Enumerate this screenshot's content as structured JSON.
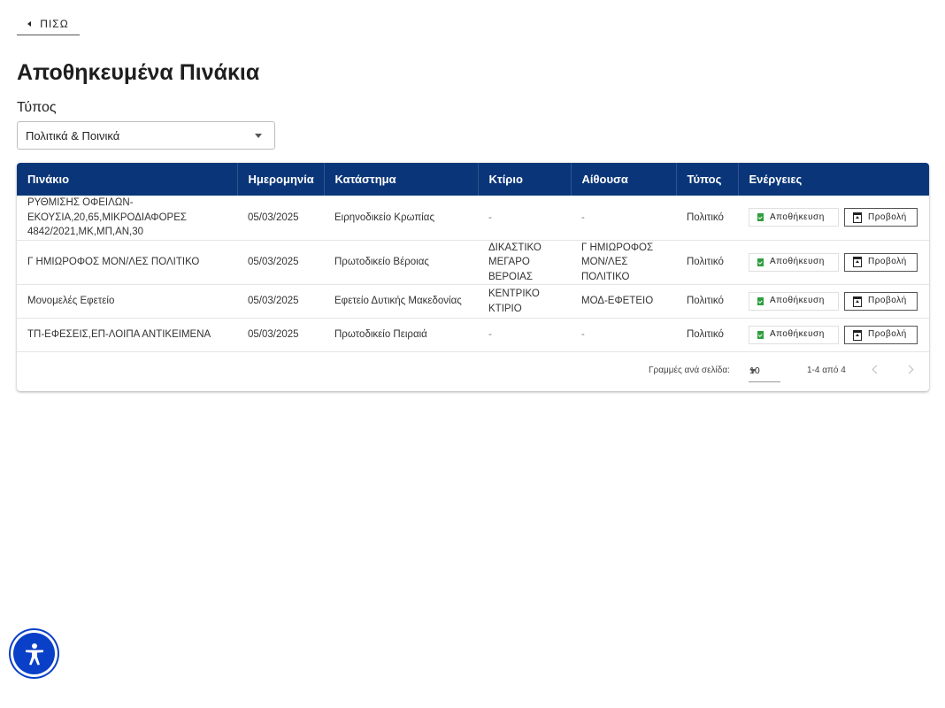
{
  "back": {
    "label": "ΠΙΣΩ"
  },
  "page": {
    "title": "Αποθηκευμένα Πινάκια"
  },
  "filter": {
    "label": "Τύπος",
    "selected": "Πολιτικά & Ποινικά"
  },
  "table": {
    "headers": [
      "Πινάκιο",
      "Ημερομηνία",
      "Κατάστημα",
      "Κτίριο",
      "Αίθουσα",
      "Τύπος",
      "Ενέργειες"
    ],
    "rows": [
      {
        "pinakio": [
          "ΡΥΘΜΙΣΗΣ ΟΦΕΙΛΩΝ-",
          "ΕΚΟΥΣΙΑ,20,65,ΜΙΚΡΟΔΙΑΦΟΡΕΣ",
          "4842/2021,ΜΚ,ΜΠ,ΑΝ,30"
        ],
        "date": "05/03/2025",
        "store": "Ειρηνοδικείο Κρωπίας",
        "building": [
          "-"
        ],
        "room": [
          "-"
        ],
        "type": "Πολιτικό"
      },
      {
        "pinakio": [
          "Γ ΗΜΙΩΡΟΦΟΣ ΜΟΝ/ΛΕΣ ΠΟΛΙΤΙΚΟ"
        ],
        "date": "05/03/2025",
        "store": "Πρωτοδικείο Βέροιας",
        "building": [
          "ΔΙΚΑΣΤΙΚΟ",
          "ΜΕΓΑΡΟ",
          "ΒΕΡΟΙΑΣ"
        ],
        "room": [
          "Γ ΗΜΙΩΡΟΦΟΣ",
          "ΜΟΝ/ΛΕΣ",
          "ΠΟΛΙΤΙΚΟ"
        ],
        "type": "Πολιτικό"
      },
      {
        "pinakio": [
          "Μονομελές Εφετείο"
        ],
        "date": "05/03/2025",
        "store": "Εφετείο Δυτικής Μακεδονίας",
        "building": [
          "ΚΕΝΤΡΙΚΟ",
          "ΚΤΙΡΙΟ"
        ],
        "room": [
          "ΜΟΔ-ΕΦΕΤΕΙΟ"
        ],
        "type": "Πολιτικό"
      },
      {
        "pinakio": [
          "ΤΠ-ΕΦΕΣΕΙΣ,ΕΠ-ΛΟΙΠΑ ΑΝΤΙΚΕΙΜΕΝΑ"
        ],
        "date": "05/03/2025",
        "store": "Πρωτοδικείο Πειραιά",
        "building": [
          "-"
        ],
        "room": [
          "-"
        ],
        "type": "Πολιτικό"
      }
    ],
    "actions": {
      "save_label": "Αποθήκευση",
      "view_label": "Προβολή"
    }
  },
  "pagination": {
    "rows_label": "Γραμμές ανά σελίδα:",
    "rows_value": "10",
    "range": "1-4 από 4"
  },
  "colors": {
    "header_bg": "#0a3679",
    "save_icon": "#2e9e3e",
    "accessibility_button": "#0a3fc7"
  },
  "icons": [
    "chevron-left-icon",
    "dropdown-arrow-icon",
    "bookmark-check-icon",
    "open-in-view-icon",
    "accessibility-icon"
  ]
}
